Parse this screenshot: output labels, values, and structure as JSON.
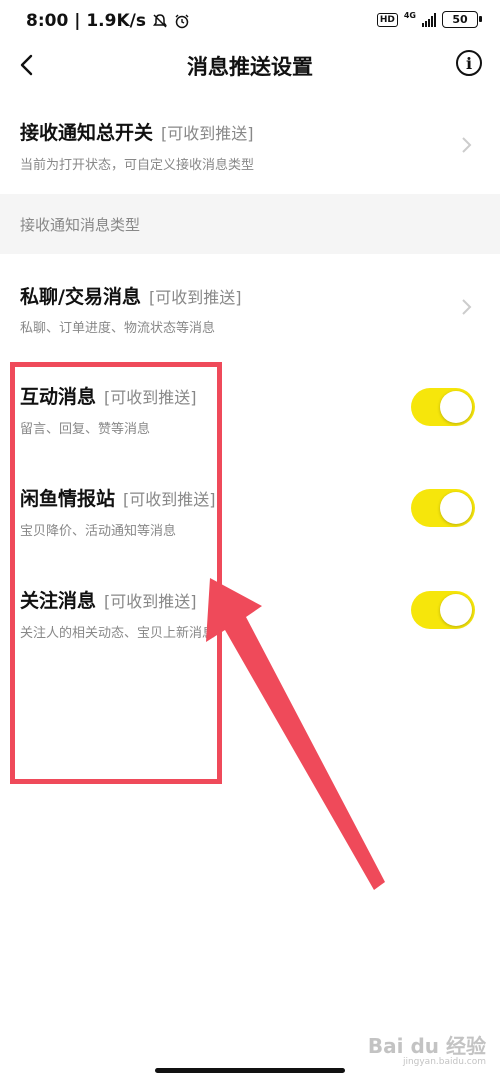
{
  "status_bar": {
    "time_speed": "8:00 | 1.9K/s",
    "hd_label": "HD",
    "network_label": "4G",
    "battery": "50",
    "icons": [
      "mute-bell-icon",
      "alarm-icon",
      "signal-icon",
      "battery-icon"
    ]
  },
  "navbar": {
    "title": "消息推送设置",
    "info_glyph": "i"
  },
  "master_switch": {
    "title": "接收通知总开关",
    "tag": "[可收到推送]",
    "subtitle": "当前为打开状态，可自定义接收消息类型"
  },
  "section": {
    "header": "接收通知消息类型"
  },
  "items": [
    {
      "title": "私聊/交易消息",
      "tag": "[可收到推送]",
      "subtitle": "私聊、订单进度、物流状态等消息",
      "control": "chevron"
    },
    {
      "title": "互动消息",
      "tag": "[可收到推送]",
      "subtitle": "留言、回复、赞等消息",
      "control": "toggle",
      "enabled": true
    },
    {
      "title": "闲鱼情报站",
      "tag": "[可收到推送]",
      "subtitle": "宝贝降价、活动通知等消息",
      "control": "toggle",
      "enabled": true
    },
    {
      "title": "关注消息",
      "tag": "[可收到推送]",
      "subtitle": "关注人的相关动态、宝贝上新消息",
      "control": "toggle",
      "enabled": true
    }
  ],
  "colors": {
    "toggle_on": "#f6e60b",
    "annotation": "#ef4a5a",
    "section_bg": "#f5f5f5"
  },
  "watermark": {
    "brand": "Bai du 经验",
    "url": "jingyan.baidu.com"
  }
}
